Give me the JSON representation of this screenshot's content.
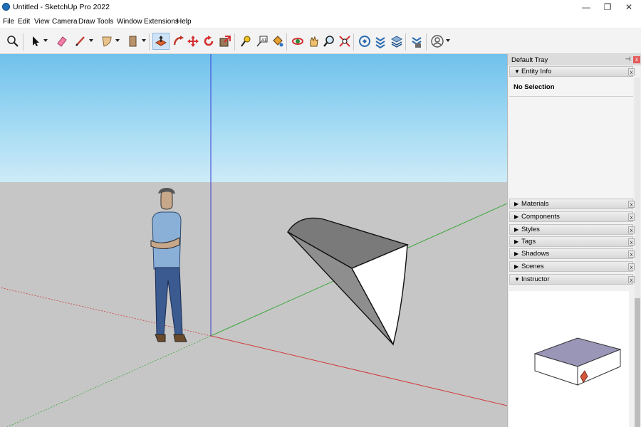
{
  "window": {
    "title": "Untitled - SketchUp Pro 2022",
    "minimize": "—",
    "maximize": "❐",
    "close": "✕"
  },
  "menu": [
    "File",
    "Edit",
    "View",
    "Camera",
    "Draw",
    "Tools",
    "Window",
    "Extensions",
    "Help"
  ],
  "toolbar": {
    "tools": [
      "zoom-extents-icon",
      "select-icon",
      "eraser-icon",
      "pencil-line-icon",
      "arc-icon",
      "rectangle-icon",
      "push-pull-icon",
      "follow-me-icon",
      "move-icon",
      "rotate-icon",
      "scale-icon",
      "tape-measure-icon",
      "text-icon",
      "paint-bucket-icon",
      "orbit-icon",
      "pan-icon",
      "zoom-icon",
      "zoom-extents-icon-2",
      "warehouse-icon",
      "extension-warehouse-icon",
      "layout-icon",
      "extension-manager-icon",
      "account-icon"
    ],
    "active_tool": "push-pull-icon"
  },
  "tray": {
    "title": "Default Tray",
    "pin": "⊣",
    "close": "x",
    "entity_info": {
      "label": "Entity Info",
      "status": "No Selection"
    },
    "panels": [
      "Materials",
      "Components",
      "Styles",
      "Tags",
      "Shadows",
      "Scenes"
    ],
    "instructor": {
      "label": "Instructor"
    },
    "expanded_marker": "▼",
    "collapsed_marker": "▶",
    "panel_close": "x"
  },
  "colors": {
    "sky_top": "#6fc1ec",
    "ground": "#c6c6c6",
    "axis_red": "#d23a3a",
    "axis_green": "#3aa83a",
    "axis_blue": "#3a3ad2",
    "active_tool_bg": "#cfe3f7"
  }
}
